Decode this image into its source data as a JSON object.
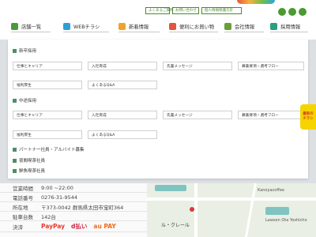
{
  "header": {
    "util_links": [
      "よくあるご質問",
      "お問い合わせ",
      "個人情報保護方針"
    ],
    "social_icons": [
      "instagram-icon",
      "twitter-icon",
      "line-icon"
    ],
    "nav": [
      {
        "label": "店舗一覧",
        "icon": "shop-icon",
        "color": "#4a9a3c"
      },
      {
        "label": "WEBチラシ",
        "icon": "flyer-icon",
        "color": "#2e9ed6"
      },
      {
        "label": "新着情報",
        "icon": "news-icon",
        "color": "#f0a22c"
      },
      {
        "label": "便利にお買い物",
        "icon": "cart-icon",
        "color": "#e0553d"
      },
      {
        "label": "会社情報",
        "icon": "company-icon",
        "color": "#6a9d3b"
      },
      {
        "label": "採用情報",
        "icon": "recruit-icon",
        "color": "#2a9e80"
      }
    ]
  },
  "menu": {
    "sections": [
      {
        "title": "新卒採用",
        "links": [
          "仕事とキャリア",
          "入社育成",
          "先輩メッセージ",
          "募集要項・選考フロー",
          "福利厚生",
          "よくあるQ&A"
        ]
      },
      {
        "title": "中途採用",
        "links": [
          "仕事とキャリア",
          "入社育成",
          "先輩メッセージ",
          "募集要項・選考フロー",
          "福利厚生",
          "よくあるQ&A"
        ]
      },
      {
        "title": "パートナー社員・アルバイト募集"
      },
      {
        "title": "夜間喫茶社員"
      },
      {
        "title": "鮮魚喫茶社員"
      }
    ]
  },
  "store_info": {
    "hours_label": "営業時間",
    "hours_value": "9:00 ~22:00",
    "phone_label": "電話番号",
    "phone_value": "0276-31-9544",
    "address_label": "所在地",
    "address_value": "〒373-0042 群馬県太田市宝町364",
    "parking_label": "駐車台数",
    "parking_value": "142台",
    "payment_label": "決済",
    "payment_methods": [
      {
        "name": "PayPay",
        "color": "#e8382f"
      },
      {
        "name": "d払い",
        "color": "#d01e3c"
      },
      {
        "name": "au PAY",
        "color": "#ec6c1f"
      }
    ]
  },
  "side_badge": {
    "line1": "最新の",
    "line2": "チラシ"
  },
  "map": {
    "labels": [
      "ル・クレール",
      "Kanoyacoffee",
      "Lawson Ota Yoshicho"
    ]
  },
  "colors": {
    "brand_green": "#4b8a2e",
    "badge_yellow": "#f5d400"
  }
}
